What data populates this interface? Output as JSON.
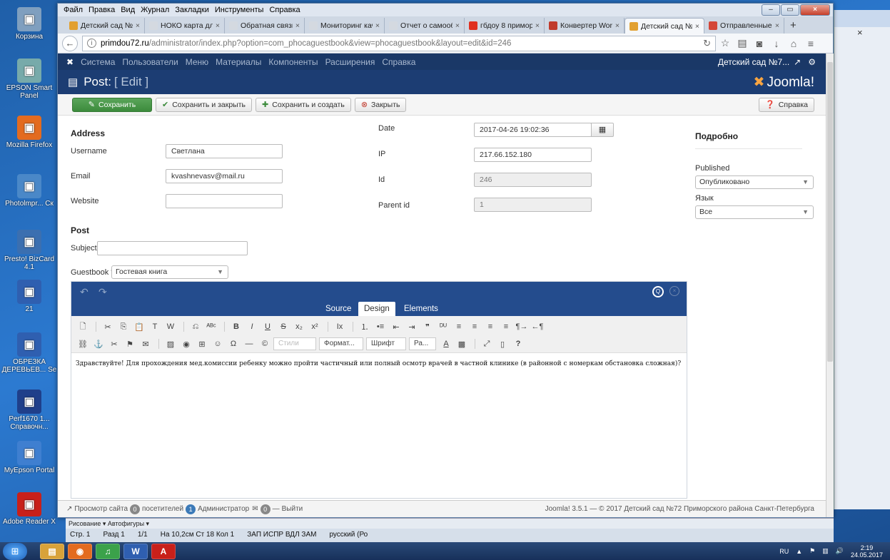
{
  "desktop": {
    "icons": [
      {
        "label": "Корзина",
        "color": "#7f9fbf"
      },
      {
        "label": "EPSON Smart Panel",
        "color": "#7aa"
      },
      {
        "label": "Mozilla Firefox",
        "color": "#e36b1f"
      },
      {
        "label": "Photolmpr... Ск",
        "color": "#4a88c8"
      },
      {
        "label": "Presto! BizCard 4.1",
        "color": "#3b6fb0"
      },
      {
        "label": "21",
        "color": "#2f5fb0"
      },
      {
        "label": "ОБРЕЗКА ДЕРЕВЬЕВ... Se",
        "color": "#2f5fb0"
      },
      {
        "label": "Perf1670 1... Справочн...",
        "color": "#1f3f8a"
      },
      {
        "label": "MyEpson Portal",
        "color": "#3f7fd0"
      },
      {
        "label": "Adobe Reader X",
        "color": "#c8201a"
      }
    ]
  },
  "browser": {
    "menu": [
      "Файл",
      "Правка",
      "Вид",
      "Журнал",
      "Закладки",
      "Инструменты",
      "Справка"
    ],
    "tabs": [
      {
        "label": "Детский сад №72",
        "color": "#e2a030",
        "active": false
      },
      {
        "label": "НОКО карта для эксп",
        "color": "#d4d9e0",
        "active": false
      },
      {
        "label": "Обратная связь",
        "color": "#d4d9e0",
        "active": false
      },
      {
        "label": "Мониторинг качеств",
        "color": "#d4d9e0",
        "active": false
      },
      {
        "label": "Отчет о самообследо",
        "color": "#d4d9e0",
        "active": false
      },
      {
        "label": "гбдоу 8 приморск",
        "color": "#e03020",
        "active": false
      },
      {
        "label": "Конвертер Word",
        "color": "#c03a2b",
        "active": false
      },
      {
        "label": "Детский сад №72",
        "color": "#e2a030",
        "active": true
      },
      {
        "label": "Отправленные -",
        "color": "#d44638",
        "active": false
      }
    ],
    "url_host": "primdou72.ru",
    "url_path": "/administrator/index.php?option=com_phocaguestbook&view=phocaguestbook&layout=edit&id=246"
  },
  "joomla": {
    "topnav": [
      "Система",
      "Пользователи",
      "Меню",
      "Материалы",
      "Компоненты",
      "Расширения",
      "Справка"
    ],
    "site_name": "Детский сад №7...",
    "page_title": "Post:",
    "page_subtitle": "[ Edit ]",
    "logo_text": "Joomla!",
    "toolbar": {
      "save": "Сохранить",
      "save_close": "Сохранить и закрыть",
      "save_new": "Сохранить и создать",
      "close": "Закрыть",
      "help": "Справка"
    },
    "form": {
      "address_heading": "Address",
      "username_label": "Username",
      "username_value": "Светлана",
      "email_label": "Email",
      "email_value": "kvashnevasv@mail.ru",
      "website_label": "Website",
      "website_value": "",
      "date_label": "Date",
      "date_value": "2017-04-26 19:02:36",
      "ip_label": "IP",
      "ip_value": "217.66.152.180",
      "id_label": "Id",
      "id_value": "246",
      "parent_label": "Parent id",
      "parent_value": "1",
      "post_heading": "Post",
      "subject_label": "Subject",
      "subject_value": "",
      "guestbook_label": "Guestbook *",
      "guestbook_value": "Гостевая книга"
    },
    "sidebar": {
      "heading": "Подробно",
      "published_label": "Published",
      "published_value": "Опубликовано",
      "language_label": "Язык",
      "language_value": "Все"
    },
    "editor": {
      "tabs": [
        "Source",
        "Design",
        "Elements"
      ],
      "active_tab": "Design",
      "dropdowns": {
        "styles": "Стили",
        "format": "Формат...",
        "font": "Шрифт",
        "size": "Ра..."
      },
      "content": "Здравствуйте! Для прохождения мед.комиссии ребенку можно пройти частичный  или полный осмотр врачей в частной клинике (в районной с номеркам обстановка сложная)?"
    },
    "status": {
      "view_site": "Просмотр сайта",
      "visitors_count": "0",
      "visitors_label": "посетителей",
      "admins_count": "1",
      "admins_label": "Администратор",
      "messages_count": "0",
      "logout": "Выйти",
      "copyright": "Joomla! 3.5.1 — © 2017 Детский сад №72 Приморского района Санкт-Петербурга"
    }
  },
  "word": {
    "drawing_toolbar": "Рисование ▾  Автофигуры ▾",
    "status": [
      "Стр. 1",
      "Разд 1",
      "1/1",
      "На 10,2см  Ст 18  Кол 1",
      "ЗАП  ИСПР  ВДЛ  ЗАМ",
      "русский (Ро"
    ]
  },
  "taskbar": {
    "lang": "RU",
    "time": "2:19",
    "date": "24.05.2017"
  }
}
